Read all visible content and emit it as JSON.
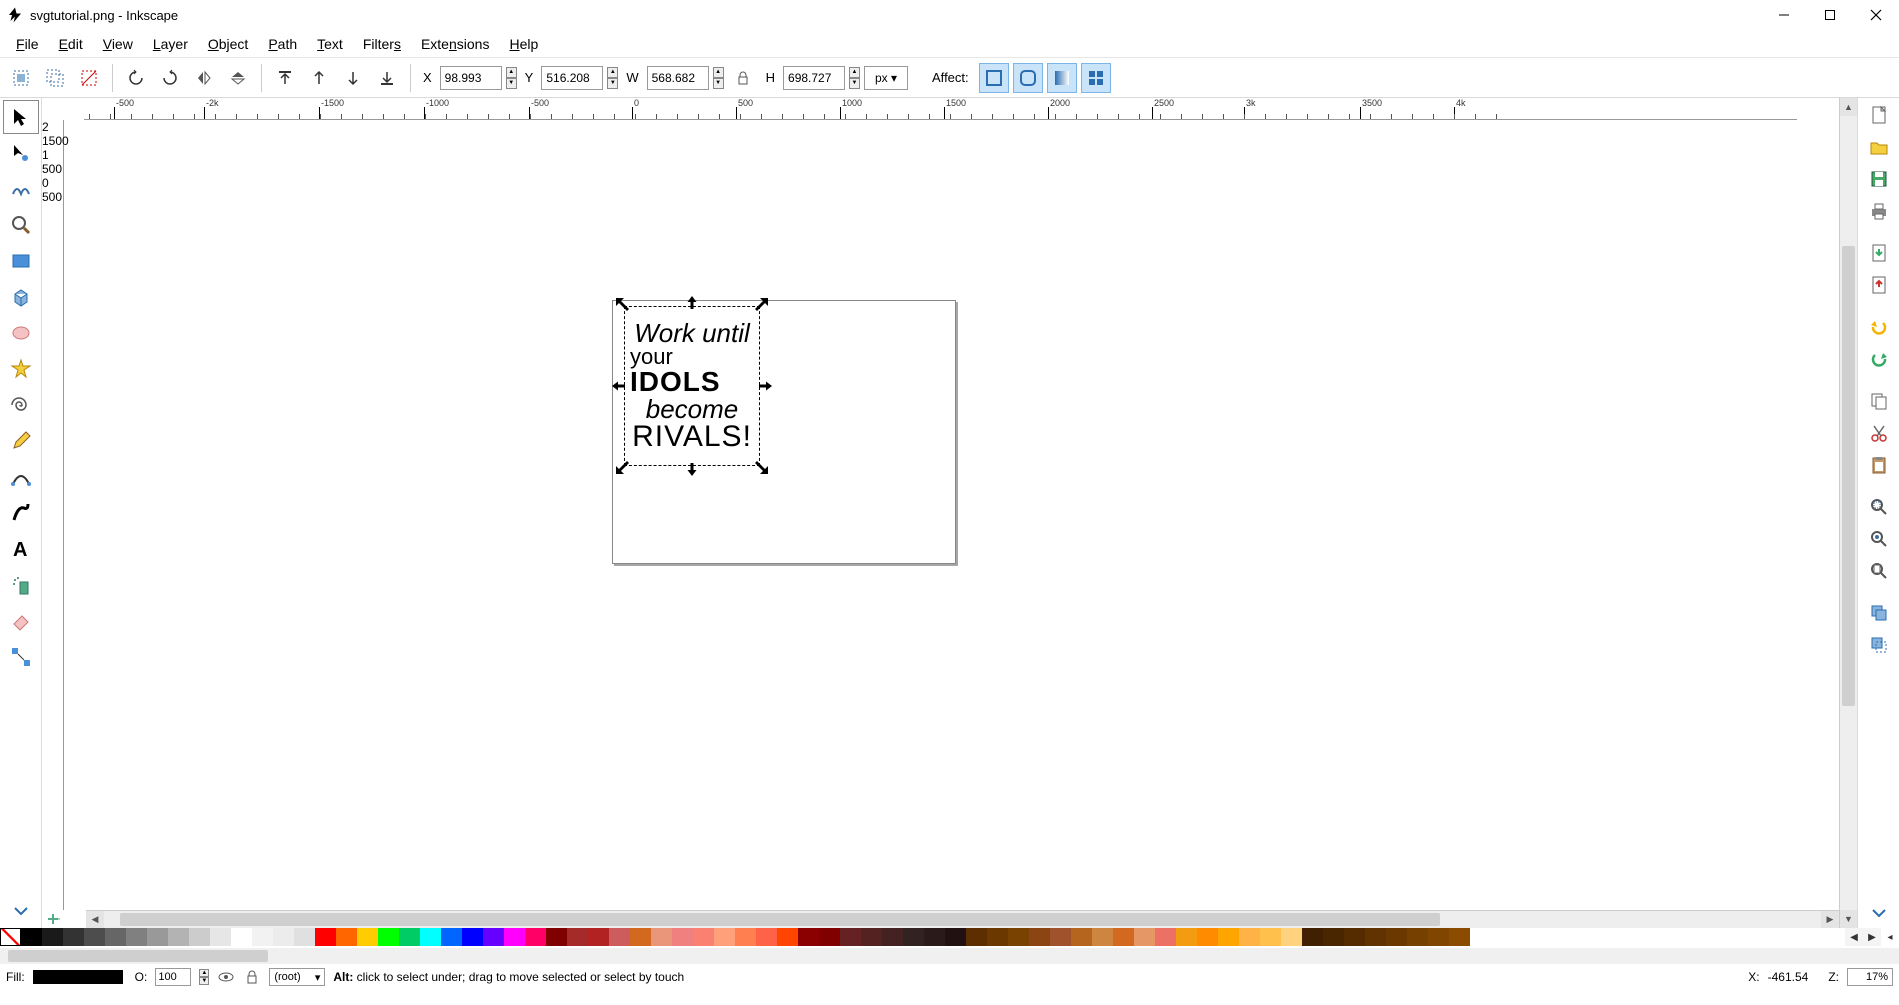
{
  "window": {
    "title": "svgtutorial.png - Inkscape"
  },
  "menu": {
    "file": "File",
    "edit": "Edit",
    "view": "View",
    "layer": "Layer",
    "object": "Object",
    "path": "Path",
    "text": "Text",
    "filters": "Filters",
    "extensions": "Extensions",
    "help": "Help"
  },
  "toolbar": {
    "x_label": "X",
    "x_value": "98.993",
    "y_label": "Y",
    "y_value": "516.208",
    "w_label": "W",
    "w_value": "568.682",
    "h_label": "H",
    "h_value": "698.727",
    "units": "px",
    "affect_label": "Affect:"
  },
  "ruler_h": [
    {
      "pos": 30,
      "label": "-500"
    },
    {
      "pos": 120,
      "label": "-2k"
    },
    {
      "pos": 235,
      "label": "-1500"
    },
    {
      "pos": 340,
      "label": "-1000"
    },
    {
      "pos": 445,
      "label": "-500"
    },
    {
      "pos": 548,
      "label": "0"
    },
    {
      "pos": 652,
      "label": "500"
    },
    {
      "pos": 756,
      "label": "1000"
    },
    {
      "pos": 860,
      "label": "1500"
    },
    {
      "pos": 964,
      "label": "2000"
    },
    {
      "pos": 1068,
      "label": "2500"
    },
    {
      "pos": 1160,
      "label": "3k"
    },
    {
      "pos": 1276,
      "label": "3500"
    },
    {
      "pos": 1370,
      "label": "4k"
    }
  ],
  "ruler_v": [
    {
      "pos": 28,
      "label": "2"
    },
    {
      "pos": 120,
      "label": "1500"
    },
    {
      "pos": 232,
      "label": "1"
    },
    {
      "pos": 326,
      "label": "500"
    },
    {
      "pos": 438,
      "label": "0"
    },
    {
      "pos": 548,
      "label": "500"
    }
  ],
  "artwork": {
    "line1": "Work until",
    "line2a": "your ",
    "line2b": "IDOLS",
    "line3": "become",
    "line4": "RIVALS!"
  },
  "palette": {
    "colors": [
      "#000000",
      "#1a1a1a",
      "#333333",
      "#4d4d4d",
      "#666666",
      "#808080",
      "#999999",
      "#b3b3b3",
      "#cccccc",
      "#e6e6e6",
      "#ffffff",
      "#f2f2f2",
      "#ececec",
      "#e0e0e0",
      "#ff0000",
      "#ff6600",
      "#ffcc00",
      "#00ff00",
      "#00cc66",
      "#00ffff",
      "#0066ff",
      "#0000ff",
      "#6600ff",
      "#ff00ff",
      "#ff0066",
      "#800000",
      "#a52a2a",
      "#b22222",
      "#cd5c5c",
      "#d2691e",
      "#e9967a",
      "#f08080",
      "#fa8072",
      "#ffa07a",
      "#ff7f50",
      "#ff6347",
      "#ff4500",
      "#8b0000",
      "#800000",
      "#662222",
      "#552222",
      "#442222",
      "#332222",
      "#2b1a1a",
      "#221111",
      "#5c2e00",
      "#6b3800",
      "#7a4200",
      "#8b4513",
      "#a0522d",
      "#b5651d",
      "#cd853f",
      "#d2691e",
      "#e59866",
      "#ec7063",
      "#f39c12",
      "#ff8c00",
      "#ffa500",
      "#ffb347",
      "#ffc04c",
      "#ffd27f",
      "#402000",
      "#4a2600",
      "#552c00",
      "#603300",
      "#6b3900",
      "#764000",
      "#804600",
      "#8b4c00"
    ]
  },
  "statusbar": {
    "fill_label": "Fill:",
    "opacity_label": "O:",
    "opacity_value": "100",
    "layer_value": "(root)",
    "hint_bold": "Alt:",
    "hint_rest": " click to select under; drag to move selected or select by touch",
    "cursor_label": "X:",
    "cursor_value": "-461.54",
    "zoom_label": "Z:",
    "zoom_value": "17%"
  }
}
